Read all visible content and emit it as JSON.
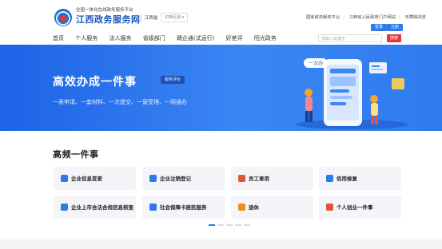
{
  "header": {
    "brand_sub": "全国一体化在线政务服务平台",
    "brand_title": "江西政务服务网",
    "region": "江西省",
    "switch_label": "切换区域",
    "top_links": [
      "国家政务服务平台",
      "江西省人民政府门户网站",
      "无障碍浏览"
    ],
    "login_label": "登录",
    "register_label": "注册"
  },
  "nav": {
    "items": [
      "首页",
      "个人服务",
      "法人服务",
      "省级部门",
      "赣企通(试运行)",
      "好差评",
      "阳光政务"
    ]
  },
  "search": {
    "placeholder": "请输入关键字",
    "button_label": "搜索"
  },
  "banner": {
    "title": "高效办成一件事",
    "tag": "服务评价",
    "subtitle": "一表申请、一套材料、一次提交、一窗受理、一网通办",
    "bubble_text": "一次办"
  },
  "section": {
    "title": "高频一件事"
  },
  "cards": [
    {
      "label": "企业信息变更",
      "icon": "building-icon",
      "color": "#2d7ae8"
    },
    {
      "label": "企业注销登记",
      "icon": "building-icon",
      "color": "#2d7ae8"
    },
    {
      "label": "员工录用",
      "icon": "user-badge-icon",
      "color": "#e2553a"
    },
    {
      "label": "信用修复",
      "icon": "shield-icon",
      "color": "#2d7ae8"
    },
    {
      "label": "企业上市合法合规信息核查",
      "icon": "document-icon",
      "color": "#2d7ae8"
    },
    {
      "label": "社会保障卡居民服务",
      "icon": "card-icon",
      "color": "#2d7ae8"
    },
    {
      "label": "退休",
      "icon": "clock-icon",
      "color": "#f08a24"
    },
    {
      "label": "个人创业一件事",
      "icon": "person-icon",
      "color": "#e2553a"
    }
  ],
  "carousel": {
    "pages": 5,
    "active_index": 0
  },
  "colors": {
    "primary": "#2d7ae8",
    "banner": "#2a75ee",
    "accent_red": "#e23a3a"
  }
}
